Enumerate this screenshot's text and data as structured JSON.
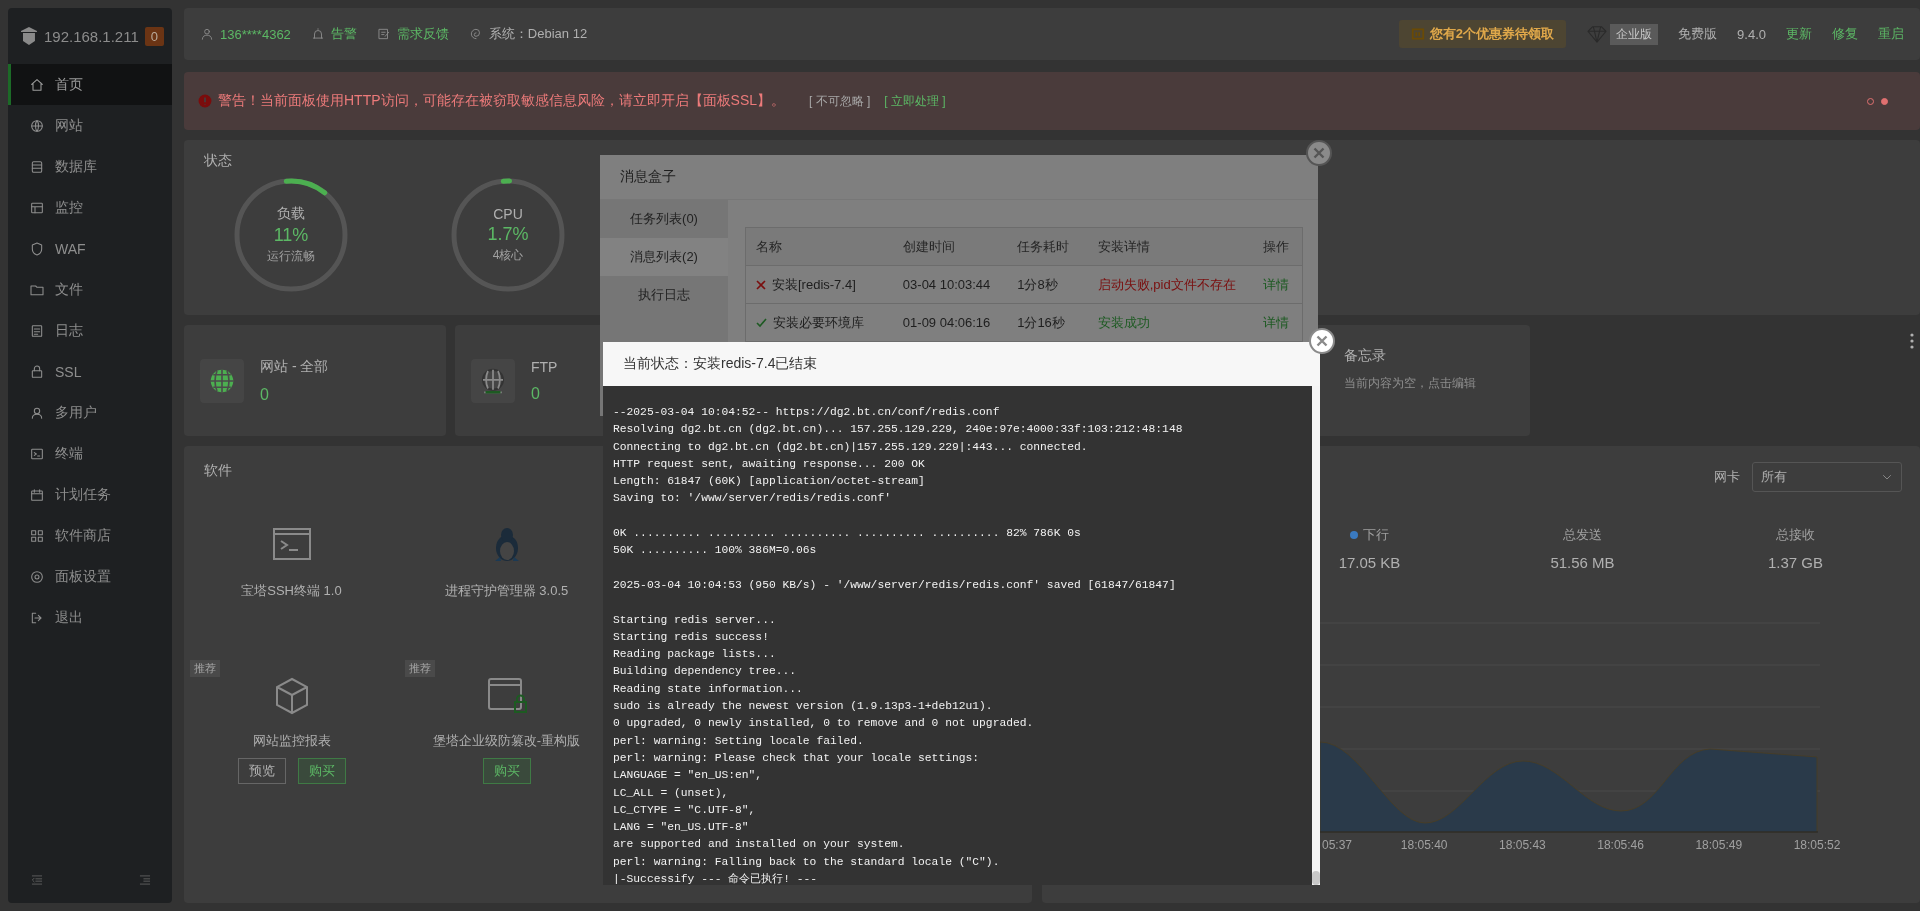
{
  "sidebar": {
    "host": "192.168.1.211",
    "badge": "0",
    "items": [
      {
        "label": "首页",
        "selected": true
      },
      {
        "label": "网站",
        "selected": false
      },
      {
        "label": "数据库",
        "selected": false
      },
      {
        "label": "监控",
        "selected": false
      },
      {
        "label": "WAF",
        "selected": false
      },
      {
        "label": "文件",
        "selected": false
      },
      {
        "label": "日志",
        "selected": false
      },
      {
        "label": "SSL",
        "selected": false
      },
      {
        "label": "多用户",
        "selected": false
      },
      {
        "label": "终端",
        "selected": false
      },
      {
        "label": "计划任务",
        "selected": false
      },
      {
        "label": "软件商店",
        "selected": false
      },
      {
        "label": "面板设置",
        "selected": false
      },
      {
        "label": "退出",
        "selected": false
      }
    ]
  },
  "topbar": {
    "links": [
      {
        "kind": "user",
        "label": "136****4362"
      },
      {
        "kind": "alarm",
        "label": "告警"
      },
      {
        "kind": "feedback",
        "label": "需求反馈"
      },
      {
        "kind": "system",
        "label": "系统：Debian 12"
      }
    ],
    "coupon": "您有2个优惠券待领取",
    "enterprise": "企业版",
    "edition": "免费版",
    "version": "9.4.0",
    "actions": [
      "更新",
      "修复",
      "重启"
    ]
  },
  "warning": {
    "text": "警告！当前面板使用HTTP访问，可能存在被窃取敏感信息风险，请立即开启【面板SSL】。",
    "ignore": "[ 不可忽略 ]",
    "fix": "[ 立即处理 ]",
    "pager": [
      {
        "selected": false
      },
      {
        "selected": true
      }
    ]
  },
  "status": {
    "title": "状态",
    "gauges": [
      {
        "label": "负载",
        "value": "11%",
        "caption": "运行流畅",
        "level": 0.11
      },
      {
        "label": "CPU",
        "value": "1.7%",
        "caption": "4核心",
        "level": 0.017
      }
    ]
  },
  "overview": [
    {
      "label": "网站 - 全部",
      "value": "0"
    },
    {
      "label": "FTP",
      "value": "0"
    }
  ],
  "memo": {
    "title": "备忘录",
    "hint": "当前内容为空，点击编辑"
  },
  "software": {
    "title": "软件",
    "items": [
      {
        "name": "宝塔SSH终端 1.0"
      },
      {
        "name": "进程守护管理器 3.0.5"
      },
      {
        "name": "网站监控报表",
        "tag": "推荐",
        "buttons": [
          {
            "label": "预览",
            "kind": "plain"
          },
          {
            "label": "购买",
            "kind": "primary"
          }
        ]
      },
      {
        "name": "堡塔企业级防篡改-重构版",
        "tag": "推荐",
        "buttons": [
          {
            "label": "购买",
            "kind": "primary"
          }
        ]
      }
    ]
  },
  "network": {
    "nic_label": "网卡",
    "nic_value": "所有",
    "stats": [
      {
        "kind": "legend",
        "label": "下行",
        "value": "17.05 KB"
      },
      {
        "kind": "total",
        "label": "总发送",
        "value": "51.56 MB"
      },
      {
        "kind": "total",
        "label": "总接收",
        "value": "1.37 GB"
      }
    ],
    "x_labels": [
      "05:37",
      "18:05:40",
      "18:05:43",
      "18:05:46",
      "18:05:49",
      "18:05:52"
    ]
  },
  "message_box": {
    "title": "消息盒子",
    "tabs": [
      {
        "label": "任务列表(0)",
        "selected": false
      },
      {
        "label": "消息列表(2)",
        "selected": true
      },
      {
        "label": "执行日志",
        "selected": false
      }
    ],
    "columns": [
      "名称",
      "创建时间",
      "任务耗时",
      "安装详情",
      "操作"
    ],
    "rows": [
      {
        "failed": true,
        "name": "安装[redis-7.4]",
        "created": "03-04 10:03:44",
        "duration": "1分8秒",
        "detail": "启动失败,pid文件不存在",
        "action": "详情"
      },
      {
        "failed": false,
        "name": "安装必要环境库",
        "created": "01-09 04:06:16",
        "duration": "1分16秒",
        "detail": "安装成功",
        "action": "详情"
      }
    ]
  },
  "log_dialog": {
    "title": "当前状态：安装redis-7.4已结束",
    "log": "--2025-03-04 10:04:52-- https://dg2.bt.cn/conf/redis.conf\nResolving dg2.bt.cn (dg2.bt.cn)... 157.255.129.229, 240e:97e:4000:33f:103:212:48:148\nConnecting to dg2.bt.cn (dg2.bt.cn)|157.255.129.229|:443... connected.\nHTTP request sent, awaiting response... 200 OK\nLength: 61847 (60K) [application/octet-stream]\nSaving to: '/www/server/redis/redis.conf'\n\n0K .......... .......... .......... .......... .......... 82% 786K 0s\n50K .......... 100% 386M=0.06s\n\n2025-03-04 10:04:53 (950 KB/s) - '/www/server/redis/redis.conf' saved [61847/61847]\n\nStarting redis server...\nStarting redis success!\nReading package lists...\nBuilding dependency tree...\nReading state information...\nsudo is already the newest version (1.9.13p3-1+deb12u1).\n0 upgraded, 0 newly installed, 0 to remove and 0 not upgraded.\nperl: warning: Setting locale failed.\nperl: warning: Please check that your locale settings:\nLANGUAGE = \"en_US:en\",\nLC_ALL = (unset),\nLC_CTYPE = \"C.UTF-8\",\nLANG = \"en_US.UTF-8\"\nare supported and installed on your system.\nperl: warning: Falling back to the standard locale (\"C\").\n|-Successify --- 命令已执行! ---"
  }
}
